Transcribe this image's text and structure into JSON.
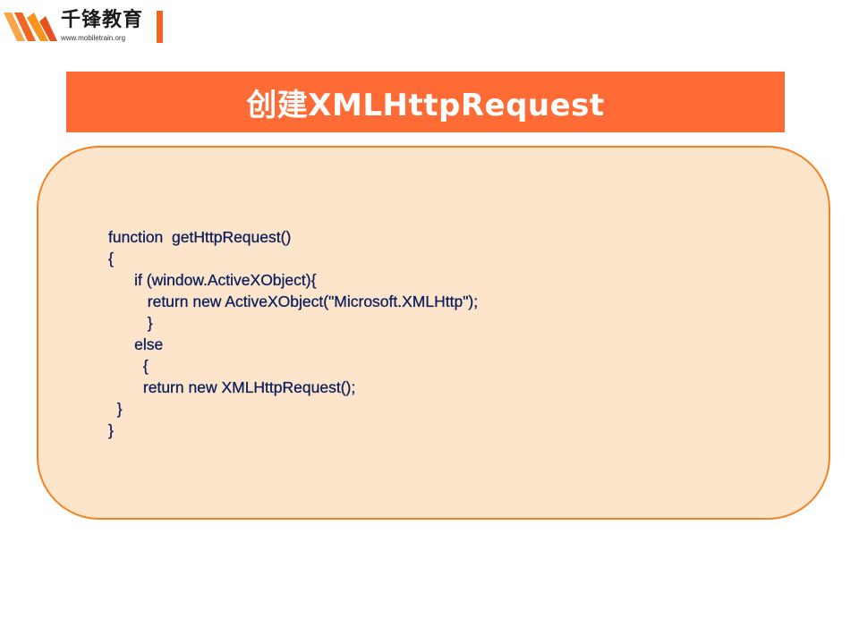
{
  "logo": {
    "name_cn": "千锋教育",
    "url": "www.mobiletrain.org",
    "colors": {
      "mark_dark": "#f26522",
      "mark_light": "#f9a64a",
      "bar": "#f26522"
    }
  },
  "title": {
    "text": "创建XMLHttpRequest",
    "background": "#ff6b35",
    "color": "#ffffff"
  },
  "code_box": {
    "background": "#fde5cc",
    "border": "#f48222",
    "text_color": "#0d1f5c",
    "lines": [
      "function  getHttpRequest()",
      "{",
      "      if (window.ActiveXObject){",
      "         return new ActiveXObject(\"Microsoft.XMLHttp\");",
      "         }",
      "      else",
      "        {",
      "        return new XMLHttpRequest();",
      "  }",
      "}"
    ]
  }
}
